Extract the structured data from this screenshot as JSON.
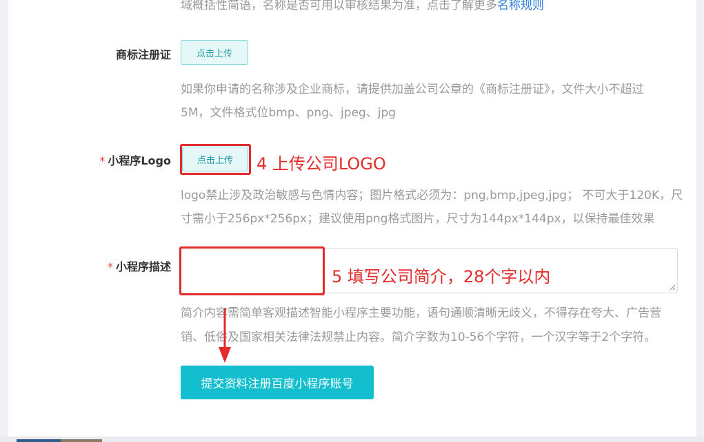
{
  "top_hint": {
    "text": "域概括性简语，名称是否可用以审核结果为准，点击了解更多",
    "link": "名称规则"
  },
  "trademark": {
    "label": "商标注册证",
    "upload_label": "点击上传",
    "help_line1": "如果你申请的名称涉及企业商标，请提供加盖公司公章的《商标注册证》，文件大小不超过",
    "help_line2": "5M，文件格式位bmp、png、jpeg、jpg"
  },
  "logo": {
    "required_mark": "*",
    "label": "小程序Logo",
    "upload_label": "点击上传",
    "annotation": "4 上传公司LOGO",
    "help_line1": "logo禁止涉及政治敏感与色情内容；图片格式必须为：png,bmp,jpeg,jpg；  不可大于120K，尺",
    "help_line2": "寸需小于256px*256px；建议使用png格式图片，尺寸为144px*144px，以保持最佳效果"
  },
  "description": {
    "required_mark": "*",
    "label": "小程序描述",
    "value": "",
    "annotation": "5 填写公司简介，28个字以内",
    "help_line1": "简介内容需简单客观描述智能小程序主要功能，语句通顺清晰无歧义，不得存在夸大、广告营",
    "help_line2": "销、低俗及国家相关法律法规禁止内容。简介字数为10-56个字符，一个汉字等于2个字符。"
  },
  "submit": {
    "label": "提交资料注册百度小程序账号"
  },
  "colors": {
    "accent": "#13bfcf",
    "annotation_red": "#e52a2a",
    "link_blue": "#2b7de1"
  }
}
